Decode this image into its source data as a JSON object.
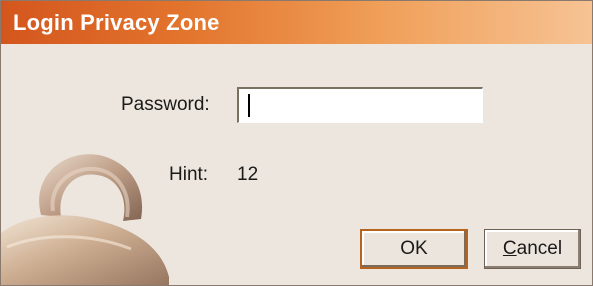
{
  "window": {
    "title": "Login Privacy Zone"
  },
  "form": {
    "password_label": "Password:",
    "password_value": "",
    "hint_label": "Hint:",
    "hint_value": "12"
  },
  "buttons": {
    "ok_label": "OK",
    "cancel_mnemonic": "C",
    "cancel_rest": "ancel"
  },
  "icons": {
    "decoration": "padlock-icon"
  },
  "colors": {
    "title_start": "#d4561e",
    "title_end": "#f6c394",
    "background": "#ede6df",
    "default_button_border": "#b5631f"
  }
}
